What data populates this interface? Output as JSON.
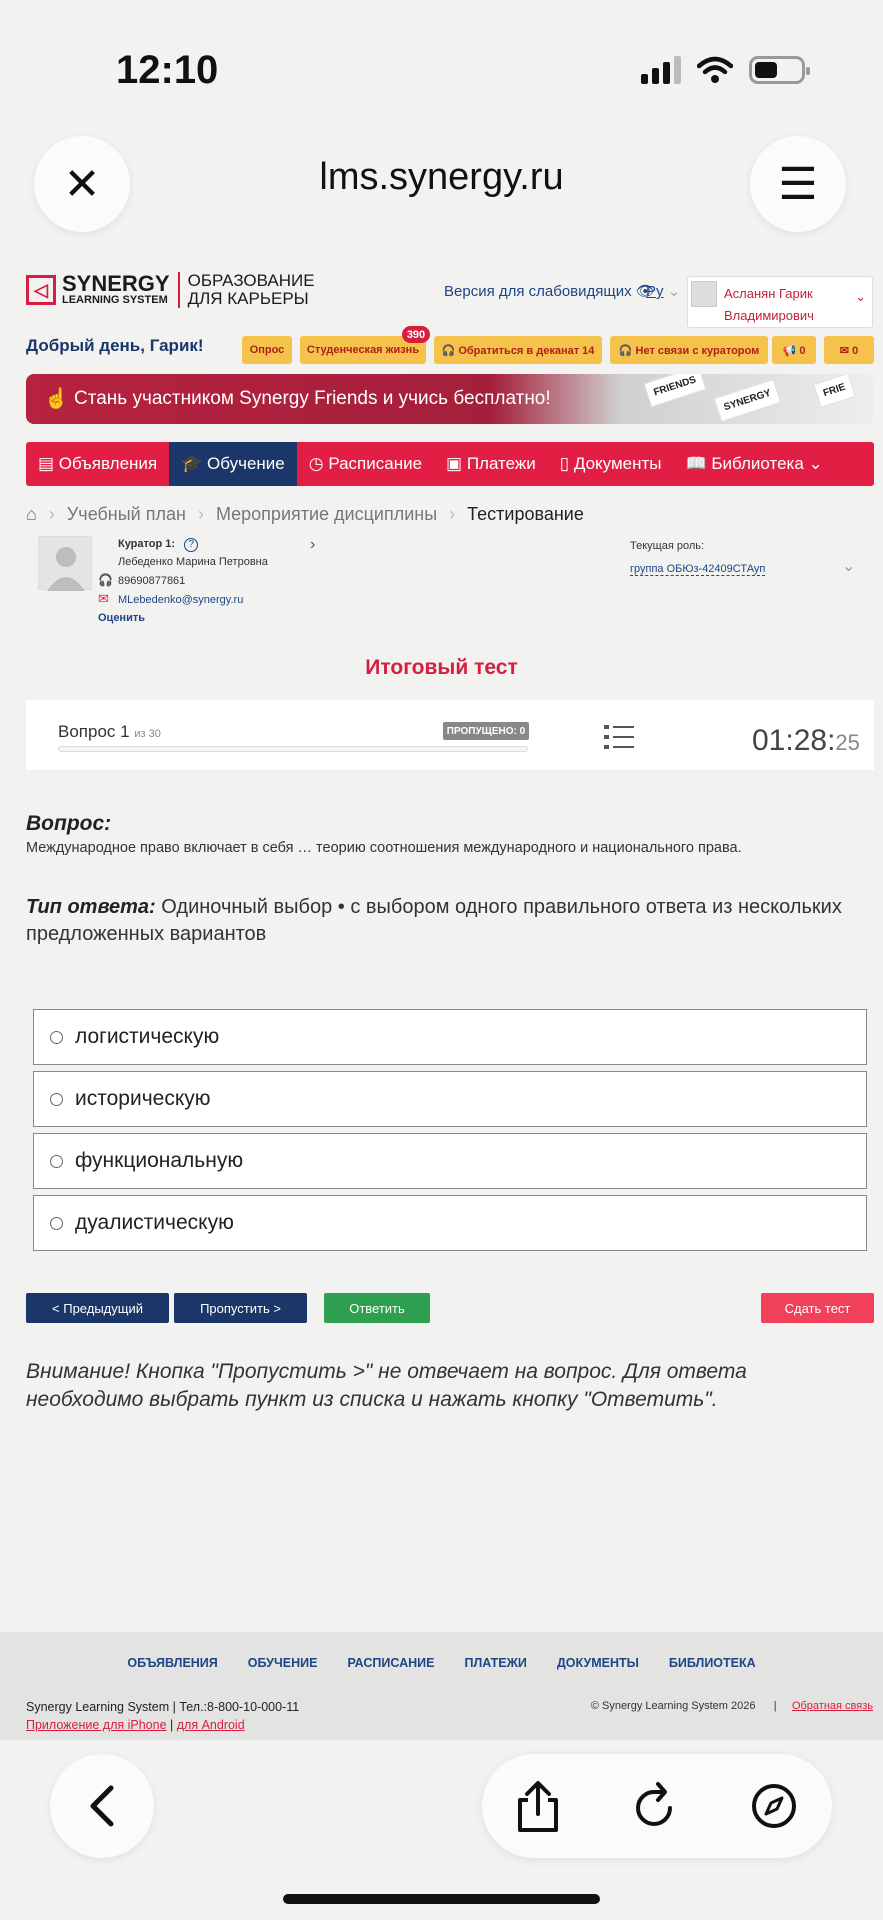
{
  "status": {
    "time": "12:10"
  },
  "browser": {
    "url": "lms.synergy.ru",
    "close_icon": "✕",
    "tabs_icon": "☰"
  },
  "header": {
    "logo_line1": "SYNERGY",
    "logo_line2": "LEARNING SYSTEM",
    "logo_right1": "ОБРАЗОВАНИЕ",
    "logo_right2": "ДЛЯ КАРЬЕРЫ",
    "accessibility": "Версия для слабовидящих 👁",
    "lang": "Ру",
    "user_name_1": "Асланян Гарик",
    "user_name_2": "Владимирович",
    "greeting": "Добрый день, Гарик!"
  },
  "quick_buttons": {
    "poll": "Опрос",
    "student_life": "Студенческая жизнь",
    "student_life_badge": "390",
    "dean": "🎧 Обратиться в деканат 14",
    "curator_nocontact": "🎧 Нет связи с куратором",
    "announce_count": "📢 0",
    "mail_count": "✉ 0"
  },
  "promo": {
    "text": "Стань участником Synergy Friends и учись бесплатно!",
    "card1": "FRIENDS",
    "card2": "SYNERGY",
    "card3": "FRIE"
  },
  "nav": {
    "announcements": "▤ Объявления",
    "learning": "🎓 Обучение",
    "schedule": "◷ Расписание",
    "payments": "▣ Платежи",
    "documents": "▯ Документы",
    "library": "📖 Библиотека ⌄"
  },
  "breadcrumbs": {
    "home": "⌂",
    "plan": "Учебный план",
    "event": "Мероприятие дисциплины",
    "current": "Тестирование"
  },
  "curator": {
    "title": "Куратор 1:",
    "help": "?",
    "name": "Лебеденко Марина Петровна",
    "phone": "89690877861",
    "email": "MLebedenko@synergy.ru",
    "rate": "Оценить",
    "role_label": "Текущая роль:",
    "role_value": "группа ОБЮз-42409СТАуп"
  },
  "test": {
    "title": "Итоговый тест",
    "question_label": "Вопрос 1",
    "question_of": "из 30",
    "skipped": "ПРОПУЩЕНО: 0",
    "timer_main": "01:28:",
    "timer_sec": "25",
    "vopros_heading": "Вопрос:",
    "vopros_text": "Международное право включает в себя … теорию соотношения международного и национального права.",
    "type_heading": "Тип ответа:",
    "type_text": "Одиночный выбор • с выбором одного правильного ответа из нескольких предложенных вариантов",
    "options": [
      "логистическую",
      "историческую",
      "функциональную",
      "дуалистическую"
    ],
    "btn_prev": "< Предыдущий",
    "btn_skip": "Пропустить >",
    "btn_answer": "Ответить",
    "btn_finish": "Сдать тест",
    "note": "Внимание! Кнопка \"Пропустить >\" не отвечает на вопрос. Для ответа необходимо выбрать пункт из списка и нажать кнопку \"Ответить\"."
  },
  "footer": {
    "nav": [
      "ОБЪЯВЛЕНИЯ",
      "ОБУЧЕНИЕ",
      "РАСПИСАНИЕ",
      "ПЛАТЕЖИ",
      "ДОКУМЕНТЫ",
      "БИБЛИОТЕКА"
    ],
    "line1": "Synergy Learning System  |  Тел.:8-800-10-000-11",
    "iphone": "Приложение для iPhone",
    "sep": " | ",
    "android": "для Android",
    "copyright": "© Synergy Learning System 2026      |     ",
    "feedback": "Обратная связь"
  },
  "colors": {
    "brand_red": "#e31e44",
    "nav_active": "#1b3769",
    "answer_green": "#2e9e4f",
    "finish_red": "#f0405a"
  }
}
